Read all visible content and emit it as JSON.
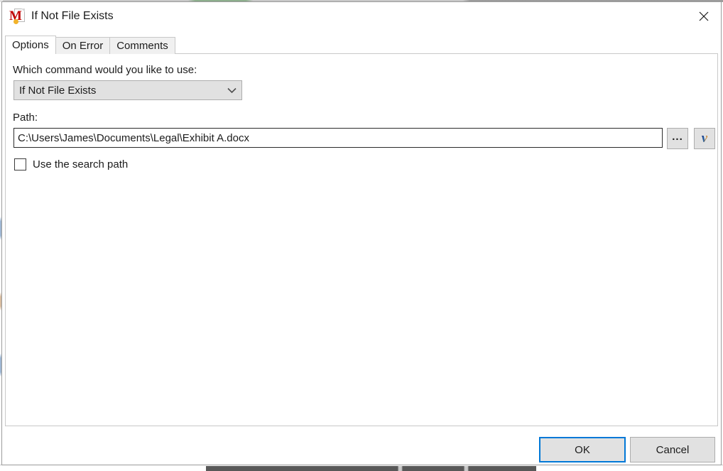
{
  "window": {
    "title": "If Not File Exists",
    "app_icon": "macro-document-icon",
    "close_label": "×"
  },
  "tabs": [
    {
      "label": "Options",
      "active": true
    },
    {
      "label": "On Error",
      "active": false
    },
    {
      "label": "Comments",
      "active": false
    }
  ],
  "form": {
    "command_label": "Which command would you like to use:",
    "command_value": "If Not File Exists",
    "command_options": [
      "If Not File Exists"
    ],
    "path_label": "Path:",
    "path_value": "C:\\Users\\James\\Documents\\Legal\\Exhibit A.docx",
    "path_placeholder": "",
    "browse_button_label": "...",
    "variable_button_label": "v",
    "search_path_label": "Use the search path",
    "search_path_checked": false
  },
  "footer": {
    "ok_label": "OK",
    "cancel_label": "Cancel"
  },
  "colors": {
    "accent": "#0078d7",
    "dialog_bg": "#ffffff",
    "control_bg": "#e1e1e1",
    "control_border": "#adadad",
    "tab_inactive_bg": "#f0f0f0",
    "panel_border": "#c8c8c8",
    "text": "#1c1c1c",
    "logo_red": "#c00000",
    "logo_gold": "#f2b32a"
  }
}
